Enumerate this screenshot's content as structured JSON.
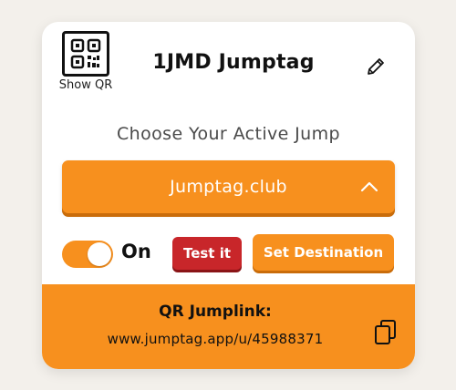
{
  "header": {
    "qr_label": "Show QR",
    "title": "1JMD Jumptag"
  },
  "main": {
    "subtitle": "Choose Your Active Jump",
    "dropdown_value": "Jumptag.club",
    "toggle_label": "On",
    "toggle_on": true,
    "test_button": "Test it",
    "destination_button": "Set Destination"
  },
  "footer": {
    "title": "QR Jumplink:",
    "link": "www.jumptag.app/u/45988371"
  },
  "icons": {
    "qr": "qr-code-icon",
    "edit": "pencil-icon",
    "dropdown": "chevron-up-icon",
    "copy": "copy-icon"
  },
  "colors": {
    "accent": "#f7901e",
    "danger": "#c8262a",
    "background": "#f3f0eb"
  }
}
